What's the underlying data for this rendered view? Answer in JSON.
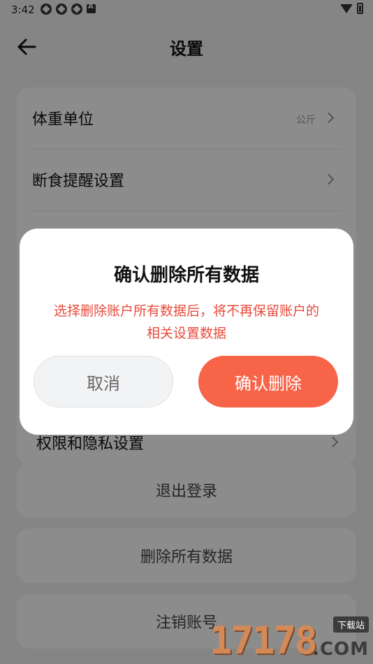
{
  "status_bar": {
    "time": "3:42"
  },
  "header": {
    "title": "设置",
    "back_icon": "arrow-left-icon"
  },
  "settings": {
    "rows": [
      {
        "label": "体重单位",
        "value": "公斤"
      },
      {
        "label": "断食提醒设置",
        "value": ""
      },
      {
        "label": "",
        "value": ""
      },
      {
        "label": "",
        "value": ""
      },
      {
        "label": "权限和隐私设置",
        "value": ""
      }
    ]
  },
  "actions": {
    "logout": "退出登录",
    "delete_all": "删除所有数据",
    "close_account": "注销账号"
  },
  "dialog": {
    "title": "确认删除所有数据",
    "message": "选择删除账户所有数据后，将不再保留账户的相关设置数据",
    "cancel": "取消",
    "confirm": "确认删除"
  },
  "watermark": {
    "digits": "17178",
    "domain": ".COM",
    "badge": "下载站"
  },
  "colors": {
    "accent": "#f76448",
    "warning_text": "#e84a3a",
    "overlay": "rgba(0,0,0,0.45)"
  }
}
